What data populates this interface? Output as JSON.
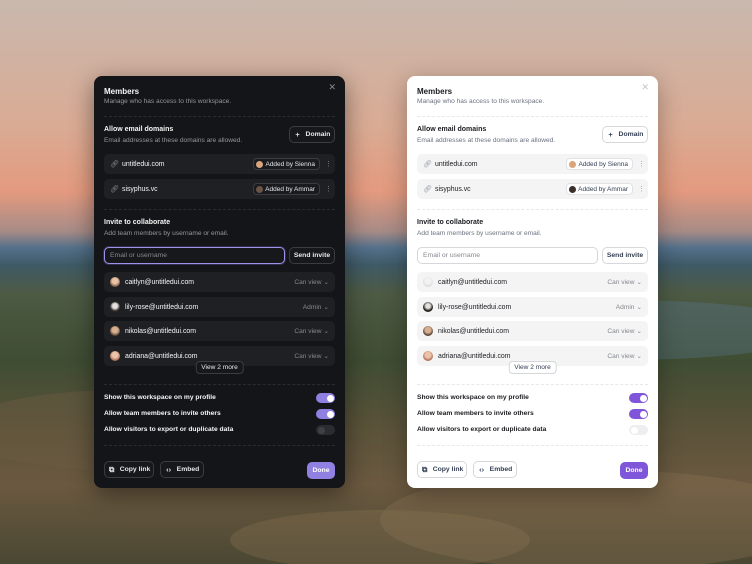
{
  "panels": {
    "dark": {
      "title": "Members",
      "subtitle": "Manage who has access to this workspace.",
      "domains_title": "Allow email domains",
      "domains_subtitle": "Email addresses at these domains are allowed.",
      "domain_button": "Domain",
      "domains": [
        {
          "domain": "untitledui.com",
          "added_by": "Added by Sienna"
        },
        {
          "domain": "sisyphus.vc",
          "added_by": "Added by Ammar"
        }
      ],
      "invite_title": "Invite to collaborate",
      "invite_subtitle": "Add team members by username or email.",
      "invite_placeholder": "Email or username",
      "send_invite": "Send invite",
      "members": [
        {
          "email": "caitlyn@untitledui.com",
          "permission": "Can view"
        },
        {
          "email": "lily-rose@untitledui.com",
          "permission": "Admin"
        },
        {
          "email": "nikolas@untitledui.com",
          "permission": "Can view"
        },
        {
          "email": "adriana@untitledui.com",
          "permission": "Can view"
        }
      ],
      "view_more": "View 2 more",
      "settings": [
        {
          "label": "Show this workspace on my profile",
          "on": true
        },
        {
          "label": "Allow team members to invite others",
          "on": true
        },
        {
          "label": "Allow visitors to export or duplicate data",
          "on": false
        }
      ],
      "copy_link": "Copy link",
      "embed": "Embed",
      "done": "Done"
    },
    "light": {
      "title": "Members",
      "subtitle": "Manage who has access to this workspace.",
      "domains_title": "Allow email domains",
      "domains_subtitle": "Email addresses at these domains are allowed.",
      "domain_button": "Domain",
      "domains": [
        {
          "domain": "untitledui.com",
          "added_by": "Added by Sienna"
        },
        {
          "domain": "sisyphus.vc",
          "added_by": "Added by Ammar"
        }
      ],
      "invite_title": "Invite to collaborate",
      "invite_subtitle": "Add team members by username or email.",
      "invite_placeholder": "Email or username",
      "send_invite": "Send invite",
      "members": [
        {
          "email": "caitlyn@untitledui.com",
          "permission": "Can view"
        },
        {
          "email": "lily-rose@untitledui.com",
          "permission": "Admin"
        },
        {
          "email": "nikolas@untitledui.com",
          "permission": "Can view"
        },
        {
          "email": "adriana@untitledui.com",
          "permission": "Can view"
        }
      ],
      "view_more": "View 2 more",
      "settings": [
        {
          "label": "Show this workspace on my profile",
          "on": true
        },
        {
          "label": "Allow team members to invite others",
          "on": true
        },
        {
          "label": "Allow visitors to export or duplicate data",
          "on": false
        }
      ],
      "copy_link": "Copy link",
      "embed": "Embed",
      "done": "Done"
    }
  },
  "icons": {
    "close": "close-icon",
    "plus": "plus-icon",
    "link": "link-icon",
    "more": "more-vertical-icon",
    "chevron": "chevron-down-icon",
    "copy": "copy-icon",
    "code": "code-icon"
  },
  "colors": {
    "accent_light": "#7f56d9",
    "accent_dark": "#9080e2",
    "dark_bg": "#141518",
    "light_bg": "#ffffff"
  }
}
